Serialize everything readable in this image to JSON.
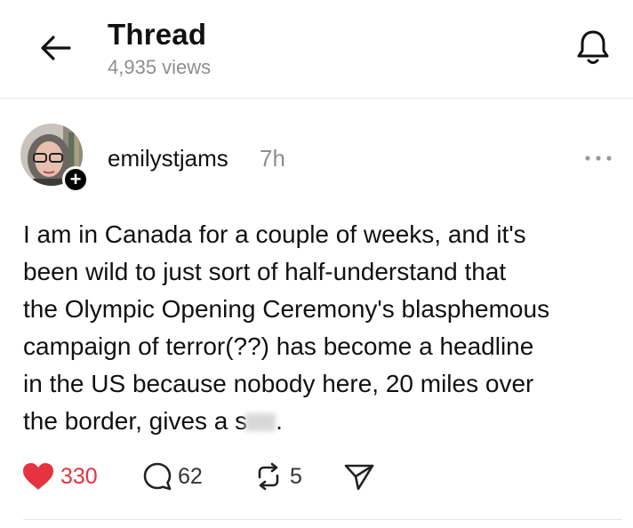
{
  "header": {
    "title": "Thread",
    "views": "4,935 views"
  },
  "post": {
    "username": "emilystjams",
    "time": "7h",
    "follow_label": "+",
    "text": "I am in Canada for a couple of weeks, and it's\nbeen wild to just sort of half-understand that\nthe Olympic Opening Ceremony's blasphemous\ncampaign of terror(??) has become a headline\nin the US because nobody here, 20 miles over\nthe border, gives a s",
    "text_tail": ".",
    "likes": "330",
    "replies": "62",
    "reposts": "5"
  },
  "colors": {
    "like": "#e5333f",
    "muted": "#8e8e8e",
    "text": "#111111"
  },
  "icons": [
    "back-arrow-icon",
    "bell-icon",
    "more-icon",
    "heart-icon",
    "reply-icon",
    "repost-icon",
    "share-icon"
  ]
}
